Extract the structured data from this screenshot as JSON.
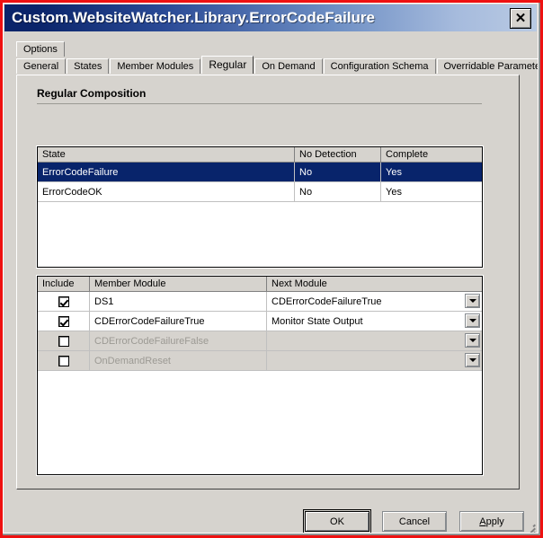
{
  "window": {
    "title": "Custom.WebsiteWatcher.Library.ErrorCodeFailure",
    "close_label": "✕"
  },
  "tabs": {
    "row1": [
      {
        "label": "Options",
        "selected": false
      }
    ],
    "row2": [
      {
        "label": "General",
        "selected": false
      },
      {
        "label": "States",
        "selected": false
      },
      {
        "label": "Member Modules",
        "selected": false
      },
      {
        "label": "Regular",
        "selected": true
      },
      {
        "label": "On Demand",
        "selected": false
      },
      {
        "label": "Configuration Schema",
        "selected": false
      },
      {
        "label": "Overridable Parameters",
        "selected": false
      }
    ]
  },
  "page": {
    "section_title": "Regular Composition"
  },
  "state_grid": {
    "columns": [
      "State",
      "No Detection",
      "Complete"
    ],
    "rows": [
      {
        "state": "ErrorCodeFailure",
        "no_detection": "No",
        "complete": "Yes",
        "selected": true
      },
      {
        "state": "ErrorCodeOK",
        "no_detection": "No",
        "complete": "Yes",
        "selected": false
      }
    ]
  },
  "module_grid": {
    "columns": [
      "Include",
      "Member Module",
      "Next Module"
    ],
    "rows": [
      {
        "include": true,
        "member_module": "DS1",
        "next_module": "CDErrorCodeFailureTrue",
        "disabled": false
      },
      {
        "include": true,
        "member_module": "CDErrorCodeFailureTrue",
        "next_module": "Monitor State Output",
        "disabled": false
      },
      {
        "include": false,
        "member_module": "CDErrorCodeFailureFalse",
        "next_module": "",
        "disabled": true
      },
      {
        "include": false,
        "member_module": "OnDemandReset",
        "next_module": "",
        "disabled": true
      }
    ]
  },
  "buttons": {
    "ok": "OK",
    "cancel": "Cancel",
    "apply_mnemonic": "A",
    "apply_rest": "pply"
  },
  "colors": {
    "title_gradient_start": "#0a246a",
    "title_gradient_end": "#b9cae3",
    "selection": "#08246b",
    "dialog_face": "#d6d3ce",
    "annotation_border": "#ee1111"
  }
}
